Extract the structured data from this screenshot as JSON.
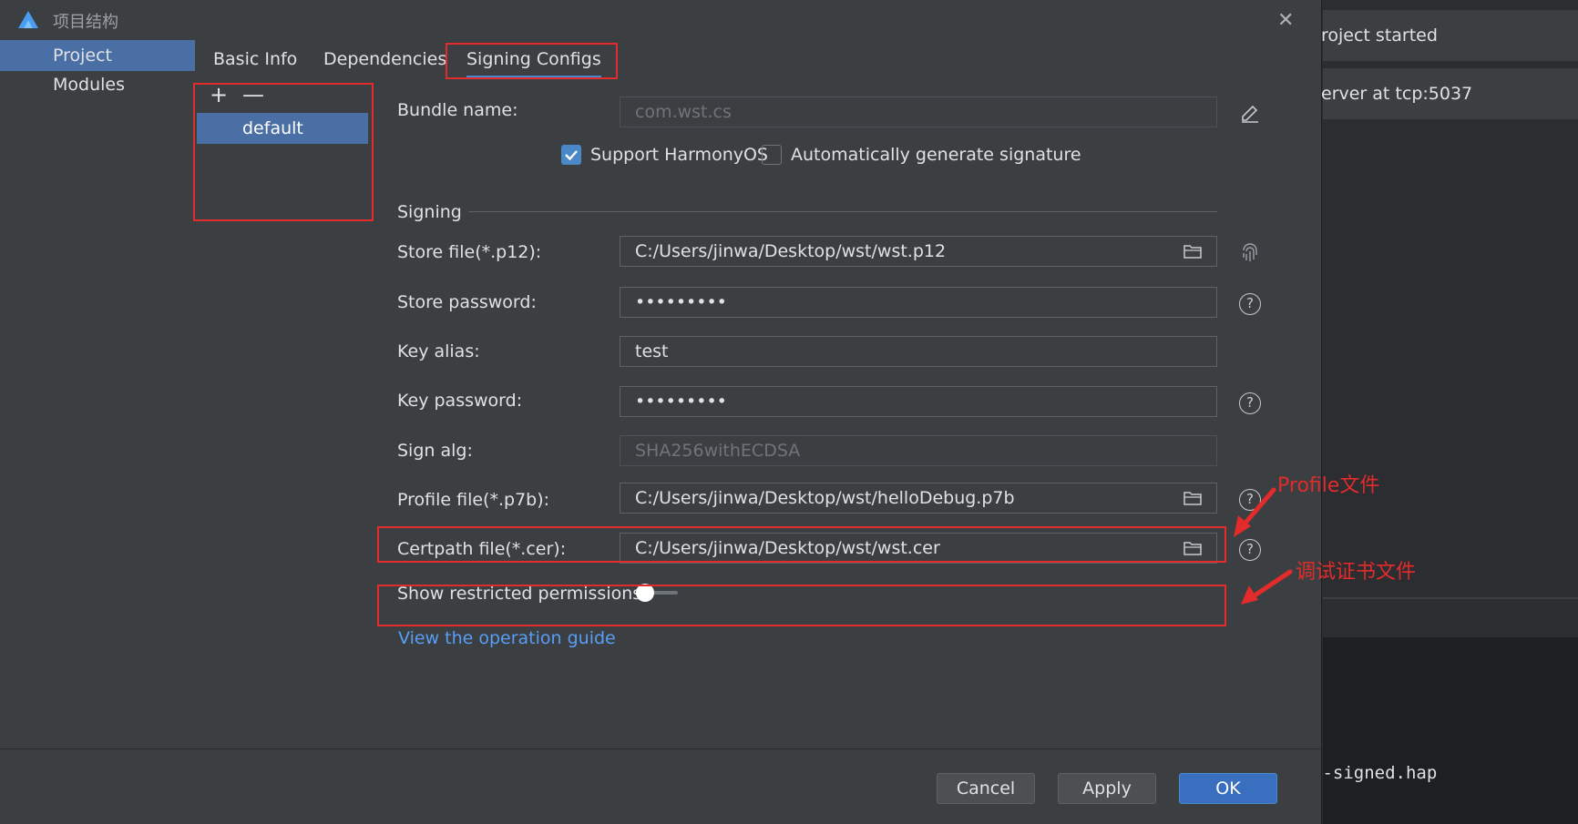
{
  "background": {
    "row1": "roject started",
    "row2": "erver at tcp:5037",
    "console_text": "t-signed.hap"
  },
  "dialog": {
    "title": "项目结构",
    "close_icon": "close-icon"
  },
  "leftnav": {
    "items": [
      {
        "label": "Project",
        "active": true
      },
      {
        "label": "Modules",
        "active": false
      }
    ]
  },
  "tabs": [
    {
      "label": "Basic Info",
      "active": false
    },
    {
      "label": "Dependencies",
      "active": false
    },
    {
      "label": "Signing Configs",
      "active": true
    }
  ],
  "configs": {
    "add": "+",
    "remove": "—",
    "items": [
      "default"
    ]
  },
  "form": {
    "bundle_name": {
      "label": "Bundle name:",
      "value": "com.wst.cs"
    },
    "support_harmony": {
      "label": "Support HarmonyOS",
      "checked": true
    },
    "auto_sign": {
      "label": "Automatically generate signature",
      "checked": false
    },
    "section": "Signing",
    "store_file": {
      "label": "Store file(*.p12):",
      "value": "C:/Users/jinwa/Desktop/wst/wst.p12"
    },
    "store_password": {
      "label": "Store password:",
      "value": "•••••••••"
    },
    "key_alias": {
      "label": "Key alias:",
      "value": "test"
    },
    "key_password": {
      "label": "Key password:",
      "value": "•••••••••"
    },
    "sign_alg": {
      "label": "Sign alg:",
      "value": "SHA256withECDSA"
    },
    "profile_file": {
      "label": "Profile file(*.p7b):",
      "value": "C:/Users/jinwa/Desktop/wst/helloDebug.p7b"
    },
    "certpath_file": {
      "label": "Certpath file(*.cer):",
      "value": "C:/Users/jinwa/Desktop/wst/wst.cer"
    },
    "restricted": {
      "label": "Show restricted permissions",
      "on": false
    },
    "guide_link": "View the operation guide"
  },
  "footer": {
    "cancel": "Cancel",
    "apply": "Apply",
    "ok": "OK"
  },
  "annotations": {
    "profile": "Profile文件",
    "cert": "调试证书文件",
    "color": "#e32b2b"
  },
  "colors": {
    "accent": "#4a6fa5",
    "link": "#589df6",
    "primary_button": "#3a6fbf"
  }
}
